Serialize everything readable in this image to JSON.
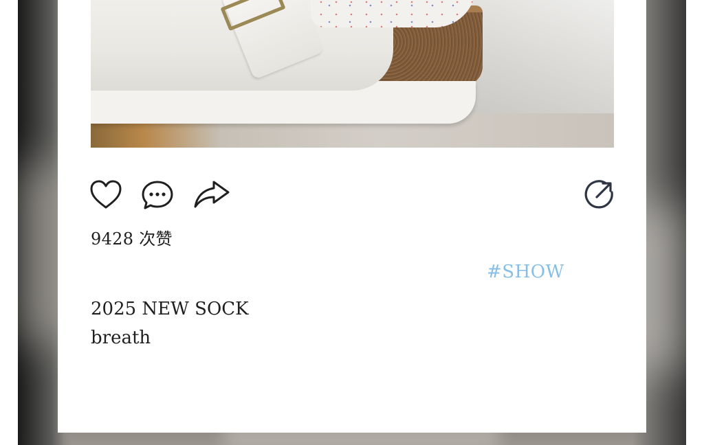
{
  "post": {
    "likes_count": "9428",
    "likes_suffix": "次赞",
    "hashtag": "#SHOW",
    "caption_line1": "2025 NEW SOCK",
    "caption_line2": "breath"
  },
  "icons": {
    "like": "heart-icon",
    "comment": "comment-bubble-icon",
    "share": "share-arrow-icon",
    "repost": "repost-circle-arrow-icon"
  },
  "colors": {
    "hashtag": "#86bfe6",
    "text": "#1f1f1f",
    "icon_stroke": "#1f1f1f",
    "repost_icon": "#2f3545"
  }
}
